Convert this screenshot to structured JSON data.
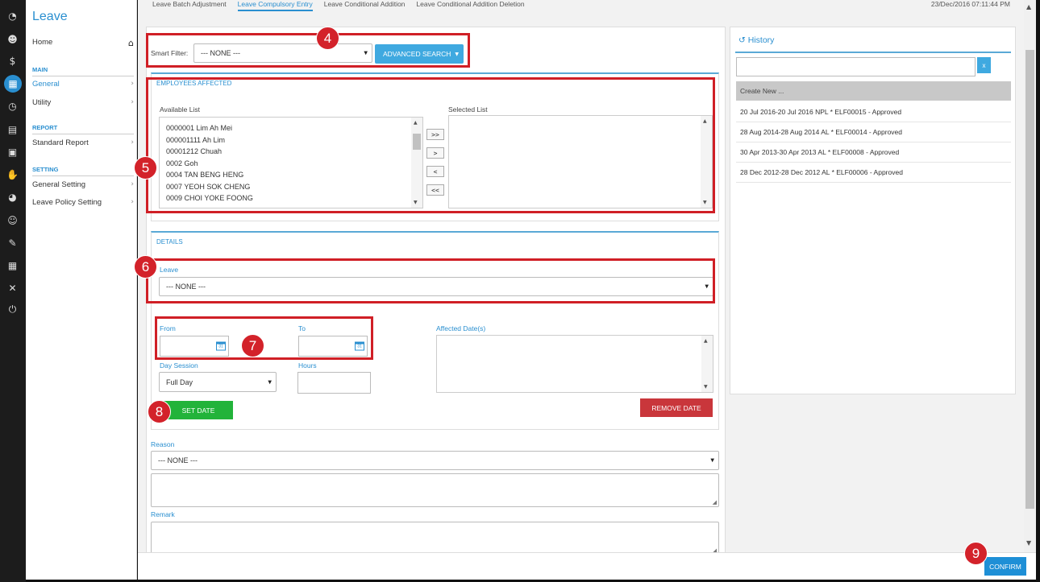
{
  "app": {
    "title": "Leave"
  },
  "sidebar": {
    "home": "Home",
    "sections": [
      {
        "heading": "MAIN",
        "items": [
          {
            "label": "General",
            "selected": true
          },
          {
            "label": "Utility"
          }
        ]
      },
      {
        "heading": "REPORT",
        "items": [
          {
            "label": "Standard Report"
          }
        ]
      },
      {
        "heading": "SETTING",
        "items": [
          {
            "label": "General Setting"
          },
          {
            "label": "Leave Policy Setting"
          }
        ]
      }
    ]
  },
  "iconbar": [
    "dashboard-icon",
    "people-icon",
    "dollar-icon",
    "calendar-icon",
    "clock-icon",
    "document-icon",
    "briefcase-icon",
    "hand-icon",
    "pie-chart-icon",
    "smile-icon",
    "notebook-icon",
    "grid-icon",
    "tools-icon",
    "power-icon"
  ],
  "tabs": [
    "Leave Batch Adjustment",
    "Leave Compulsory Entry",
    "Leave Conditional Addition",
    "Leave Conditional Addition Deletion"
  ],
  "active_tab": "Leave Compulsory Entry",
  "datetime": "23/Dec/2016 07:11:44 PM",
  "smart_filter": {
    "label": "Smart Filter:",
    "value": "--- NONE ---",
    "advanced_search": "ADVANCED SEARCH"
  },
  "employees": {
    "section_title": "EMPLOYEES AFFECTED",
    "available_label": "Available List",
    "selected_label": "Selected List",
    "available": [
      "0000001 Lim Ah Mei",
      "000001111 Ah Lim",
      "00001212 Chuah",
      "0002 Goh",
      "0004 TAN BENG HENG",
      "0007 YEOH SOK CHENG",
      "0009 CHOI YOKE FOONG"
    ],
    "move_buttons": [
      ">>",
      ">",
      "<",
      "<<"
    ]
  },
  "details": {
    "section_title": "DETAILS",
    "leave_label": "Leave",
    "leave_value": "--- NONE ---",
    "from_label": "From",
    "to_label": "To",
    "day_session_label": "Day Session",
    "day_session_value": "Full Day",
    "hours_label": "Hours",
    "affected_label": "Affected Date(s)",
    "set_date": "SET DATE",
    "remove_date": "REMOVE DATE"
  },
  "reason": {
    "label": "Reason",
    "value": "--- NONE ---"
  },
  "remark": {
    "label": "Remark"
  },
  "history": {
    "title": "History",
    "clear": "x",
    "create_new": "Create New ...",
    "items": [
      "20 Jul 2016-20 Jul 2016 NPL * ELF00015 - Approved",
      "28 Aug 2014-28 Aug 2014 AL * ELF00014 - Approved",
      "30 Apr 2013-30 Apr 2013 AL * ELF00008 - Approved",
      "28 Dec 2012-28 Dec 2012 AL * ELF00006 - Approved"
    ]
  },
  "confirm": "CONFIRM",
  "callouts": [
    "4",
    "5",
    "6",
    "7",
    "8",
    "9"
  ],
  "colors": {
    "accent": "#2a8fd0",
    "callout": "#d01f26",
    "set_date": "#22b33a",
    "remove_date": "#c9363b"
  }
}
